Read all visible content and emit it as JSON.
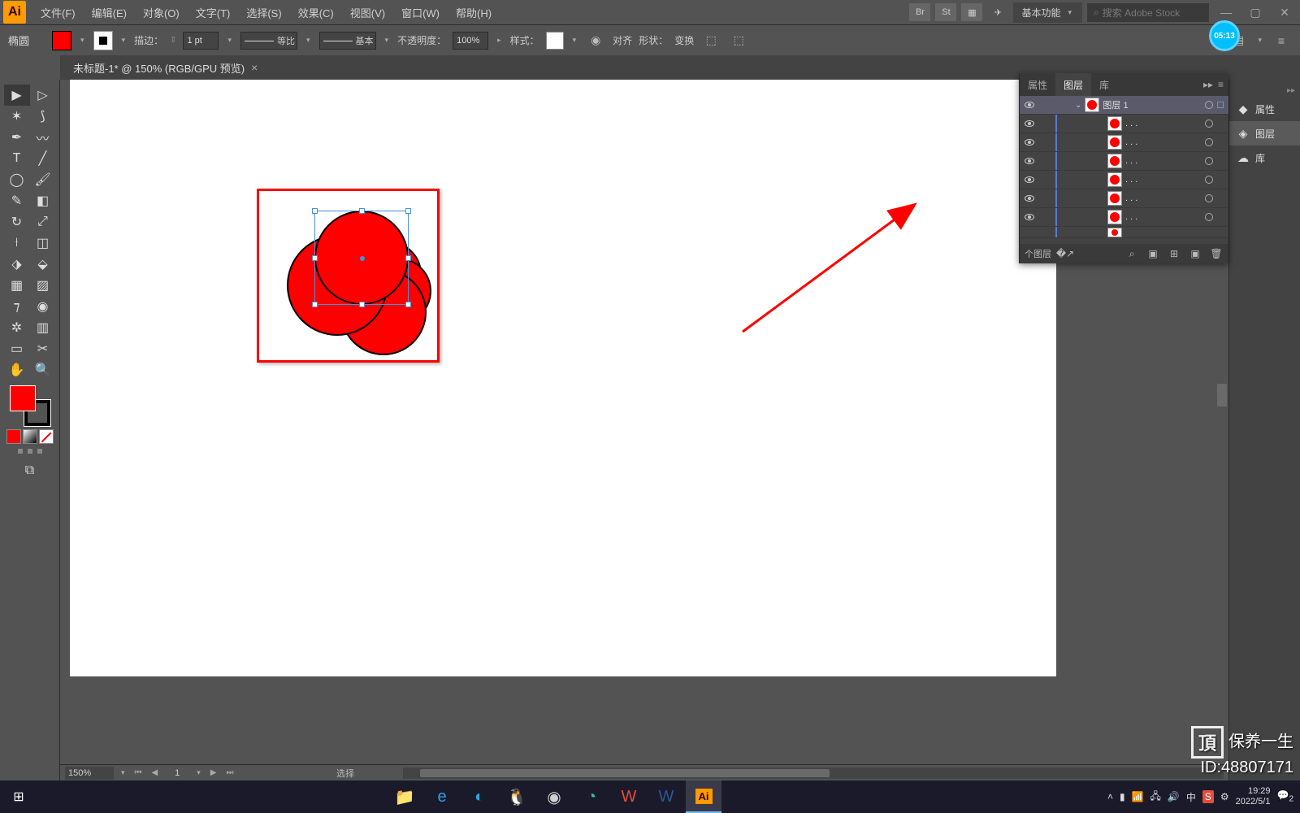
{
  "app": {
    "icon_text": "Ai"
  },
  "menu": [
    "文件(F)",
    "编辑(E)",
    "对象(O)",
    "文字(T)",
    "选择(S)",
    "效果(C)",
    "视图(V)",
    "窗口(W)",
    "帮助(H)"
  ],
  "menubar_right": {
    "br_label": "Br",
    "st_label": "St",
    "workspace": "基本功能",
    "search_placeholder": "搜索 Adobe Stock"
  },
  "control": {
    "tool_name": "椭圆",
    "stroke_label": "描边：",
    "stroke_pt": "1 pt",
    "profile_label": "等比",
    "brush_label": "基本",
    "opacity_label": "不透明度：",
    "opacity_value": "100%",
    "style_label": "样式：",
    "align_label": "对齐",
    "shape_label": "形状：",
    "transform_label": "变换",
    "timer": "05:13"
  },
  "doc_tab": {
    "title": "未标题-1* @ 150% (RGB/GPU 预览)"
  },
  "panel": {
    "tabs": [
      "属性",
      "图层",
      "库"
    ],
    "layer_main": "图层 1",
    "sublayer_label": ". . .",
    "footer_count": "个图层"
  },
  "dock": {
    "items": [
      {
        "icon": "◆",
        "label": "属性"
      },
      {
        "icon": "◈",
        "label": "图层"
      },
      {
        "icon": "☁",
        "label": "库"
      }
    ]
  },
  "statusbar": {
    "zoom": "150%",
    "artboard": "1",
    "status": "选择"
  },
  "tray": {
    "ime": "中",
    "time": "19:29",
    "date": "2022/5/1",
    "notif": "2"
  },
  "watermark": {
    "brand": "保养一生",
    "id": "ID:48807171"
  }
}
